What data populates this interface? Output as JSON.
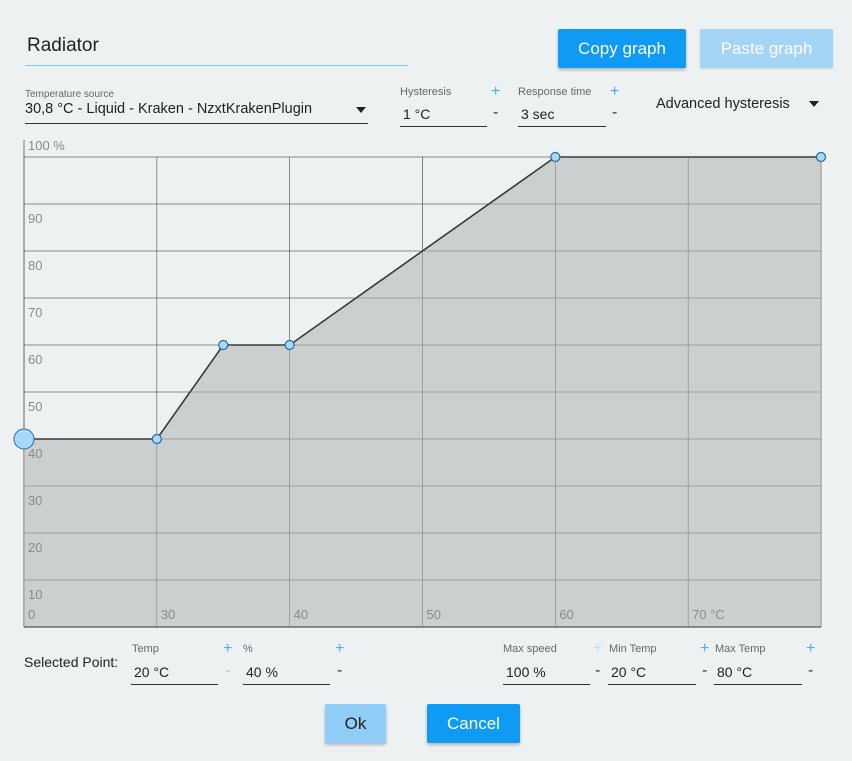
{
  "dialog": {
    "name_value": "Radiator",
    "copy_graph_label": "Copy graph",
    "paste_graph_label": "Paste graph"
  },
  "temperature_source": {
    "label": "Temperature source",
    "value": "30,8 °C - Liquid - Kraken - NzxtKrakenPlugin"
  },
  "hysteresis": {
    "label": "Hysteresis",
    "value": "1 °C",
    "plus": "+",
    "minus": "-"
  },
  "response_time": {
    "label": "Response time",
    "value": "3 sec",
    "plus": "+",
    "minus": "-"
  },
  "advanced_hysteresis": {
    "label": "Advanced hysteresis"
  },
  "colors": {
    "accent": "#0f9af4",
    "fill": "#c8cbcc",
    "point": "#a8d8fb",
    "line": "#3a3a3a",
    "grid": "#5a5a5a"
  },
  "chart_data": {
    "type": "area",
    "x_ticks": [
      "0",
      "30",
      "40",
      "50",
      "60",
      "70 °C"
    ],
    "y_ticks": [
      "100 %",
      "90",
      "80",
      "70",
      "60",
      "50",
      "40",
      "30",
      "20",
      "10"
    ],
    "xlim": [
      20,
      80
    ],
    "ylim": [
      0,
      100
    ],
    "grid": true,
    "points": [
      {
        "x": 20,
        "y": 40,
        "selected": true
      },
      {
        "x": 30,
        "y": 40
      },
      {
        "x": 35,
        "y": 60
      },
      {
        "x": 40,
        "y": 60
      },
      {
        "x": 60,
        "y": 100
      },
      {
        "x": 80,
        "y": 100
      }
    ]
  },
  "selected_point": {
    "label": "Selected Point:",
    "temp": {
      "label": "Temp",
      "value": "20 °C",
      "plus": "+",
      "minus": "-"
    },
    "percent": {
      "label": "%",
      "value": "40 %",
      "plus": "+",
      "minus": "-"
    },
    "max_speed": {
      "label": "Max speed",
      "value": "100 %",
      "plus": "+",
      "minus": "-"
    },
    "min_temp": {
      "label": "Min Temp",
      "value": "20 °C",
      "plus": "+",
      "minus": "-"
    },
    "max_temp": {
      "label": "Max Temp",
      "value": "80 °C",
      "plus": "+",
      "minus": "-"
    }
  },
  "footer": {
    "ok_label": "Ok",
    "cancel_label": "Cancel"
  }
}
